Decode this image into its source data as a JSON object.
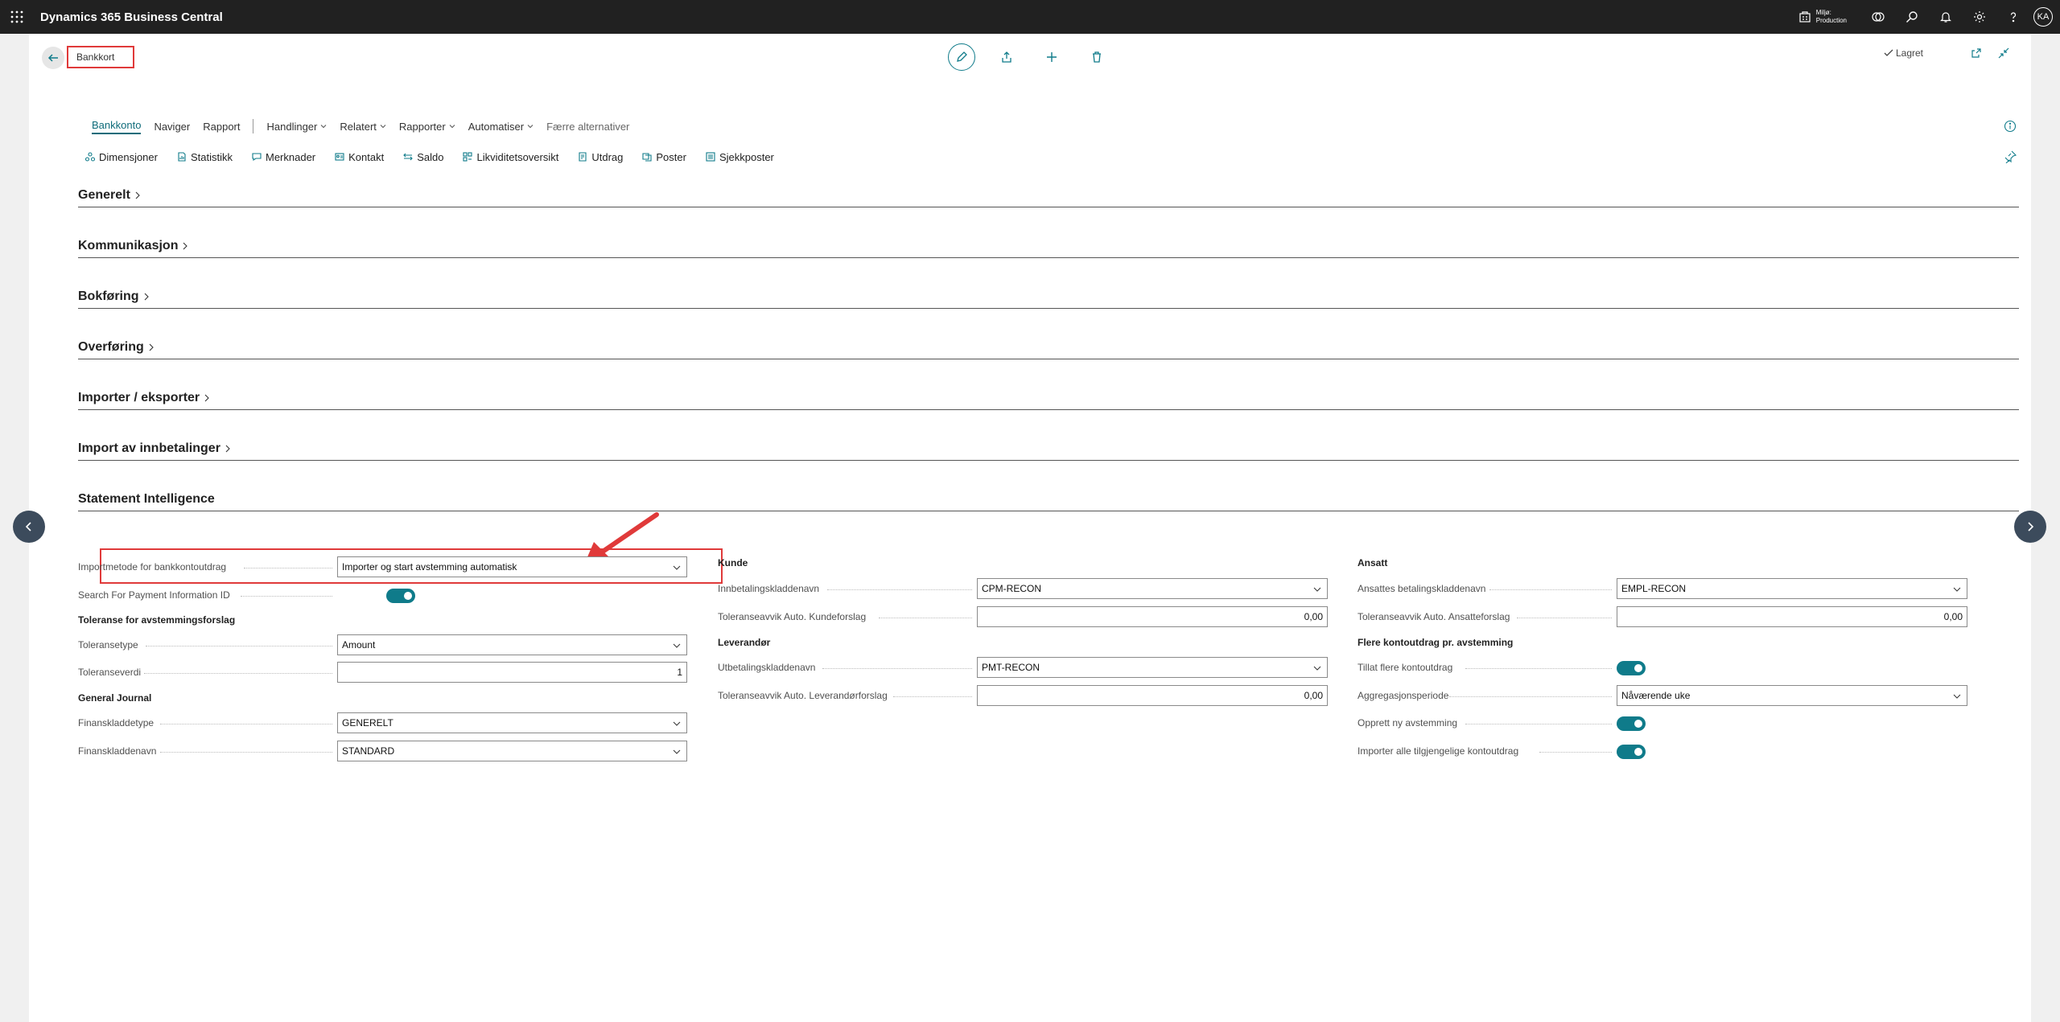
{
  "topbar": {
    "app_title": "Dynamics 365 Business Central",
    "environment_line1": "Miljø:",
    "environment_line2": "Production",
    "avatar_initials": "KA"
  },
  "page": {
    "breadcrumb": "Bankkort",
    "saved_label": "Lagret"
  },
  "actionbar": {
    "tabs": [
      {
        "label": "Bankkonto"
      },
      {
        "label": "Naviger"
      },
      {
        "label": "Rapport"
      },
      {
        "label": "Handlinger"
      },
      {
        "label": "Relatert"
      },
      {
        "label": "Rapporter"
      },
      {
        "label": "Automatiser"
      },
      {
        "label": "Færre alternativer"
      }
    ],
    "promoted": [
      {
        "label": "Dimensjoner"
      },
      {
        "label": "Statistikk"
      },
      {
        "label": "Merknader"
      },
      {
        "label": "Kontakt"
      },
      {
        "label": "Saldo"
      },
      {
        "label": "Likviditetsoversikt"
      },
      {
        "label": "Utdrag"
      },
      {
        "label": "Poster"
      },
      {
        "label": "Sjekkposter"
      }
    ]
  },
  "fasttabs": [
    {
      "title": "Generelt"
    },
    {
      "title": "Kommunikasjon"
    },
    {
      "title": "Bokføring"
    },
    {
      "title": "Overføring"
    },
    {
      "title": "Importer / eksporter"
    },
    {
      "title": "Import av innbetalinger"
    },
    {
      "title": "Statement Intelligence"
    }
  ],
  "si": {
    "col1": {
      "import_method_label": "Importmetode for bankkontoutdrag",
      "import_method_value": "Importer og start avstemming automatisk",
      "search_payment_label": "Search For Payment Information ID",
      "tolerance_group": "Toleranse for avstemmingsforslag",
      "tolerance_type_label": "Toleransetype",
      "tolerance_type_value": "Amount",
      "tolerance_value_label": "Toleranseverdi",
      "tolerance_value_value": "1",
      "gj_group": "General Journal",
      "gj_template_label": "Finanskladdetype",
      "gj_template_value": "GENERELT",
      "gj_batch_label": "Finanskladdenavn",
      "gj_batch_value": "STANDARD"
    },
    "col2": {
      "customer_group": "Kunde",
      "cust_journal_label": "Innbetalingskladdenavn",
      "cust_journal_value": "CPM-RECON",
      "cust_tol_label": "Toleranseavvik Auto. Kundeforslag",
      "cust_tol_value": "0,00",
      "vendor_group": "Leverandør",
      "vend_journal_label": "Utbetalingskladdenavn",
      "vend_journal_value": "PMT-RECON",
      "vend_tol_label": "Toleranseavvik Auto. Leverandørforslag",
      "vend_tol_value": "0,00"
    },
    "col3": {
      "employee_group": "Ansatt",
      "emp_journal_label": "Ansattes betalingskladdenavn",
      "emp_journal_value": "EMPL-RECON",
      "emp_tol_label": "Toleranseavvik Auto. Ansatteforslag",
      "emp_tol_value": "0,00",
      "multi_group": "Flere kontoutdrag pr. avstemming",
      "allow_multi_label": "Tillat flere kontoutdrag",
      "agg_period_label": "Aggregasjonsperiode",
      "agg_period_value": "Nåværende uke",
      "create_new_label": "Opprett ny avstemming",
      "import_all_label": "Importer alle tilgjengelige kontoutdrag"
    }
  },
  "colors": {
    "accent": "#0f7b8a",
    "topbar": "#212121",
    "highlight": "#e03a3a"
  }
}
